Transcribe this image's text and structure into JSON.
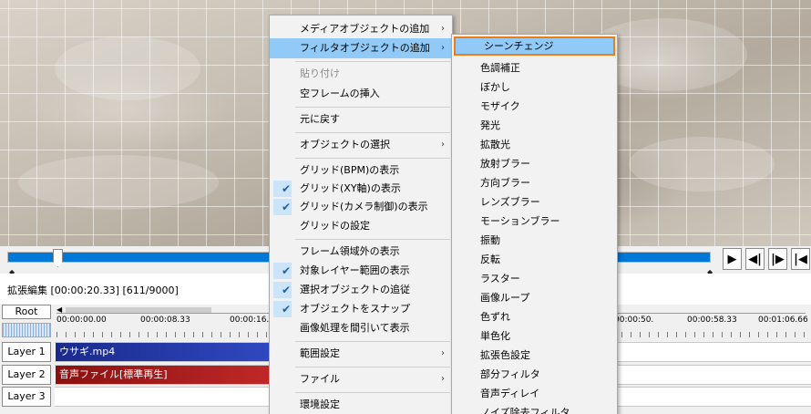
{
  "preview": {
    "description_icon": "video-frame"
  },
  "transport": {
    "play": "▶",
    "prev_frame": "◀|",
    "next_frame": "|▶",
    "go_start": "|◀"
  },
  "status": {
    "text": "拡張編集 [00:00:20.33] [611/9000]"
  },
  "timeline": {
    "root_label": "Root",
    "ruler_labels": [
      "00:00:00.00",
      "00:00:08.33",
      "00:00:16.",
      "00:00:50.",
      "00:00:58.33",
      "00:01:06.66"
    ],
    "layers": [
      {
        "label": "Layer 1",
        "clip": "ウサギ.mp4",
        "kind": "video"
      },
      {
        "label": "Layer 2",
        "clip": "音声ファイル[標準再生]",
        "kind": "audio"
      },
      {
        "label": "Layer 3",
        "clip": "",
        "kind": ""
      }
    ]
  },
  "context_menu": {
    "items": [
      {
        "label": "メディアオブジェクトの追加",
        "submenu": true
      },
      {
        "label": "フィルタオブジェクトの追加",
        "submenu": true,
        "highlight": true
      },
      {
        "label": "貼り付け",
        "disabled": true
      },
      {
        "label": "空フレームの挿入"
      },
      {
        "label": "元に戻す"
      },
      {
        "label": "オブジェクトの選択",
        "submenu": true
      },
      {
        "label": "グリッド(BPM)の表示"
      },
      {
        "label": "グリッド(XY軸)の表示",
        "checked": true
      },
      {
        "label": "グリッド(カメラ制御)の表示",
        "checked": true
      },
      {
        "label": "グリッドの設定"
      },
      {
        "label": "フレーム領域外の表示"
      },
      {
        "label": "対象レイヤー範囲の表示",
        "checked": true
      },
      {
        "label": "選択オブジェクトの追従",
        "checked": true
      },
      {
        "label": "オブジェクトをスナップ",
        "checked": true
      },
      {
        "label": "画像処理を間引いて表示"
      },
      {
        "label": "範囲設定",
        "submenu": true
      },
      {
        "label": "ファイル",
        "submenu": true
      },
      {
        "label": "環境設定"
      }
    ]
  },
  "submenu": {
    "items": [
      "シーンチェンジ",
      "色調補正",
      "ぼかし",
      "モザイク",
      "発光",
      "拡散光",
      "放射ブラー",
      "方向ブラー",
      "レンズブラー",
      "モーションブラー",
      "振動",
      "反転",
      "ラスター",
      "画像ループ",
      "色ずれ",
      "単色化",
      "拡張色設定",
      "部分フィルタ",
      "音声ディレイ",
      "ノイズ除去フィルタ"
    ],
    "active_index": 0
  },
  "colors": {
    "highlight": "#91c9f7",
    "active_border": "#f07c16",
    "seek_fill": "#0078d7",
    "video_clip": "#1a2a8c",
    "audio_clip": "#8a1010"
  },
  "seek": {
    "progress": 0.068
  }
}
